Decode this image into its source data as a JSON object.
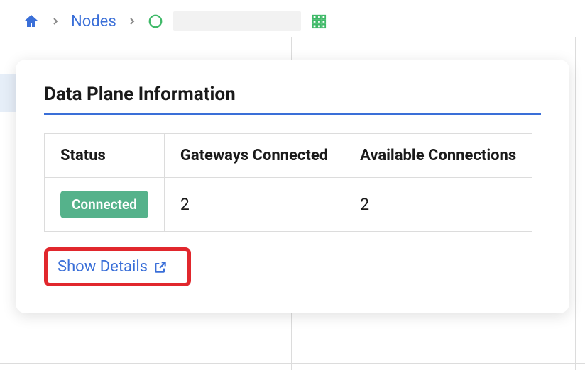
{
  "breadcrumb": {
    "nodes_label": "Nodes"
  },
  "card": {
    "title": "Data Plane Information",
    "table": {
      "headers": {
        "status": "Status",
        "gateways": "Gateways Connected",
        "available": "Available Connections"
      },
      "row": {
        "status_label": "Connected",
        "gateways": "2",
        "available": "2"
      }
    },
    "show_details_label": "Show Details"
  }
}
